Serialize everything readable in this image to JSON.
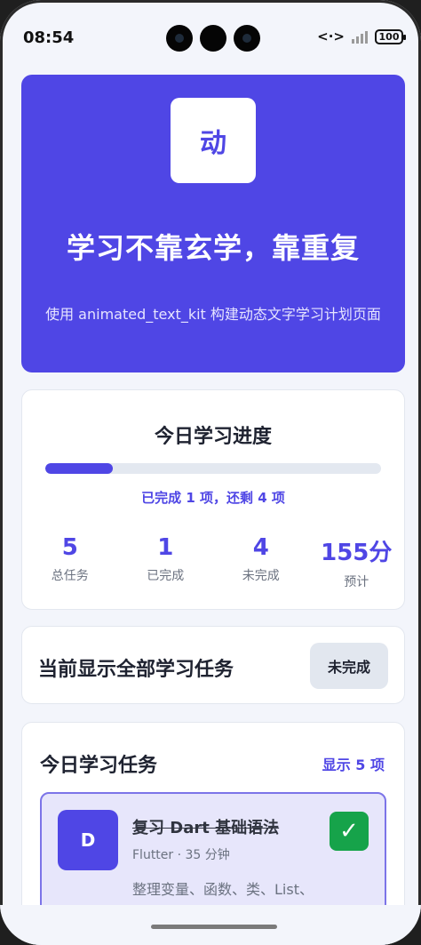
{
  "status_bar": {
    "time": "08:54",
    "data_icon": "<·>",
    "battery": "100"
  },
  "hero": {
    "badge": "动",
    "title": "学习不靠玄学，靠重复",
    "subtitle": "使用 animated_text_kit 构建动态文字学习计划页面",
    "colors": {
      "background": "#4f46e5"
    }
  },
  "progress": {
    "title": "今日学习进度",
    "fraction": 0.2,
    "status_text": "已完成 1 项，还剩 4 项",
    "stats": [
      {
        "value": "5",
        "label": "总任务"
      },
      {
        "value": "1",
        "label": "已完成"
      },
      {
        "value": "4",
        "label": "未完成"
      },
      {
        "value": "155分",
        "label": "预计"
      }
    ]
  },
  "filter": {
    "title": "当前显示全部学习任务",
    "button_label": "未完成"
  },
  "tasks": {
    "title": "今日学习任务",
    "count_label": "显示 5 项",
    "items": [
      {
        "avatar": "D",
        "name": "复习 Dart 基础语法",
        "meta": "Flutter · 35 分钟",
        "desc": "整理变量、函数、类、List、Map 的基本用法，重",
        "done_mark": "✓"
      }
    ]
  }
}
